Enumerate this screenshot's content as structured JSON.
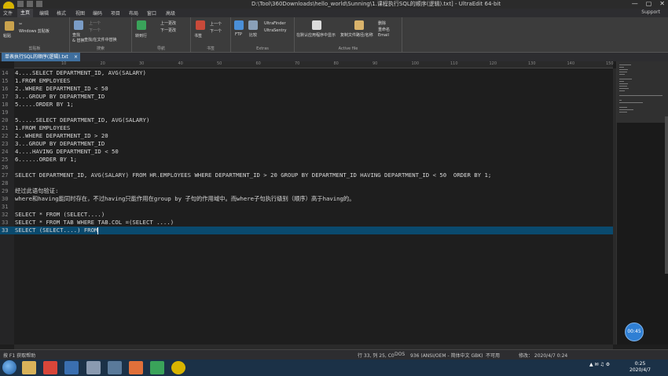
{
  "window": {
    "title": "D:\\Tool\\360Downloads\\hello_world\\Sunning\\1.课程执行SQL的顺序(逻辑).txt] - UltraEdit 64-bit",
    "controls": [
      "—",
      "▢",
      "✕"
    ]
  },
  "menu": {
    "items": [
      "文件",
      "主页",
      "编辑",
      "格式",
      "视图",
      "编码",
      "项目",
      "布局",
      "窗口",
      "高级"
    ],
    "active_index": 1,
    "support": "Support"
  },
  "ribbon": {
    "paste_label": "粘贴",
    "clipboard_label": "Windows 剪贴板",
    "clipboard_group": "剪贴板",
    "find_label": "查找",
    "replace_label": "& 替换",
    "find_in_files": "查找/在文件中替换",
    "up_label": "上一个",
    "down_label": "下一个",
    "search_group": "搜索",
    "goto_label": "转到行",
    "prev_change": "上一更改",
    "next_change": "下一更改",
    "nav_group": "导航",
    "bookmark_label": "书签",
    "bm_prev": "上一个",
    "bm_next": "下一个",
    "bookmark_group": "书签",
    "ftp_label": "FTP",
    "compare_label": "比较",
    "ultrafinder": "UltraFinder",
    "ultrasentry": "UltraSentry",
    "extras_group": "Extras",
    "open_default": "在默认应用程序中显示",
    "copy_path": "复制文件路径/名称",
    "delete_label": "删除",
    "rename_label": "重命名",
    "email_label": "Email",
    "active_file_group": "Active file"
  },
  "tab": {
    "title": "单表执行SQL的顺序(逻辑).txt",
    "close": "×"
  },
  "ruler": {
    "ticks": [
      "10",
      "20",
      "30",
      "40",
      "50",
      "60",
      "70",
      "80",
      "90",
      "100",
      "110",
      "120",
      "130",
      "140",
      "150"
    ]
  },
  "editor": {
    "lines": [
      {
        "num": "14",
        "text": "4....SELECT DEPARTMENT_ID, AVG(SALARY)"
      },
      {
        "num": "15",
        "text": "1.FROM EMPLOYEES"
      },
      {
        "num": "16",
        "text": "2..WHERE DEPARTMENT_ID < 50"
      },
      {
        "num": "17",
        "text": "3...GROUP BY DEPARTMENT_ID"
      },
      {
        "num": "18",
        "text": "5.....ORDER BY 1;"
      },
      {
        "num": "19",
        "text": ""
      },
      {
        "num": "20",
        "text": "5.....SELECT DEPARTMENT_ID, AVG(SALARY)"
      },
      {
        "num": "21",
        "text": "1.FROM EMPLOYEES"
      },
      {
        "num": "22",
        "text": "2..WHERE DEPARTMENT_ID > 20"
      },
      {
        "num": "23",
        "text": "3...GROUP BY DEPARTMENT_ID"
      },
      {
        "num": "24",
        "text": "4....HAVING DEPARTMENT_ID < 50"
      },
      {
        "num": "25",
        "text": "6......ORDER BY 1;"
      },
      {
        "num": "26",
        "text": ""
      },
      {
        "num": "27",
        "text": "SELECT DEPARTMENT_ID, AVG(SALARY) FROM HR.EMPLOYEES WHERE DEPARTMENT_ID > 20 GROUP BY DEPARTMENT_ID HAVING DEPARTMENT_ID < 50  ORDER BY 1;"
      },
      {
        "num": "28",
        "text": ""
      },
      {
        "num": "29",
        "text": "经过此语句验证:"
      },
      {
        "num": "30",
        "text": "where和having能同时存在，不过having只能作用在group by 子句的作用域中。而where子句执行级别（顺序）高于having的。"
      },
      {
        "num": "31",
        "text": ""
      },
      {
        "num": "32",
        "text": "SELECT * FROM (SELECT....)"
      },
      {
        "num": "33",
        "text": "SELECT * FROM TAB WHERE TAB.COL =(SELECT ....)"
      },
      {
        "num": "33",
        "text": "SELECT (SELECT....) FROM"
      }
    ],
    "current_line_index": 20
  },
  "overlay": {
    "timer": "00:45"
  },
  "status": {
    "help": "按 F1 获取帮助",
    "position": "行 33, 列 25, C0",
    "line_ending": "DOS",
    "codepage": "936  (ANSI/OEM - 简体中文 GBK)",
    "writable": "不可用",
    "modified": "修改： 2020/4/7 0:24"
  },
  "taskbar": {
    "time": "0:25",
    "date": "2020/4/7"
  }
}
